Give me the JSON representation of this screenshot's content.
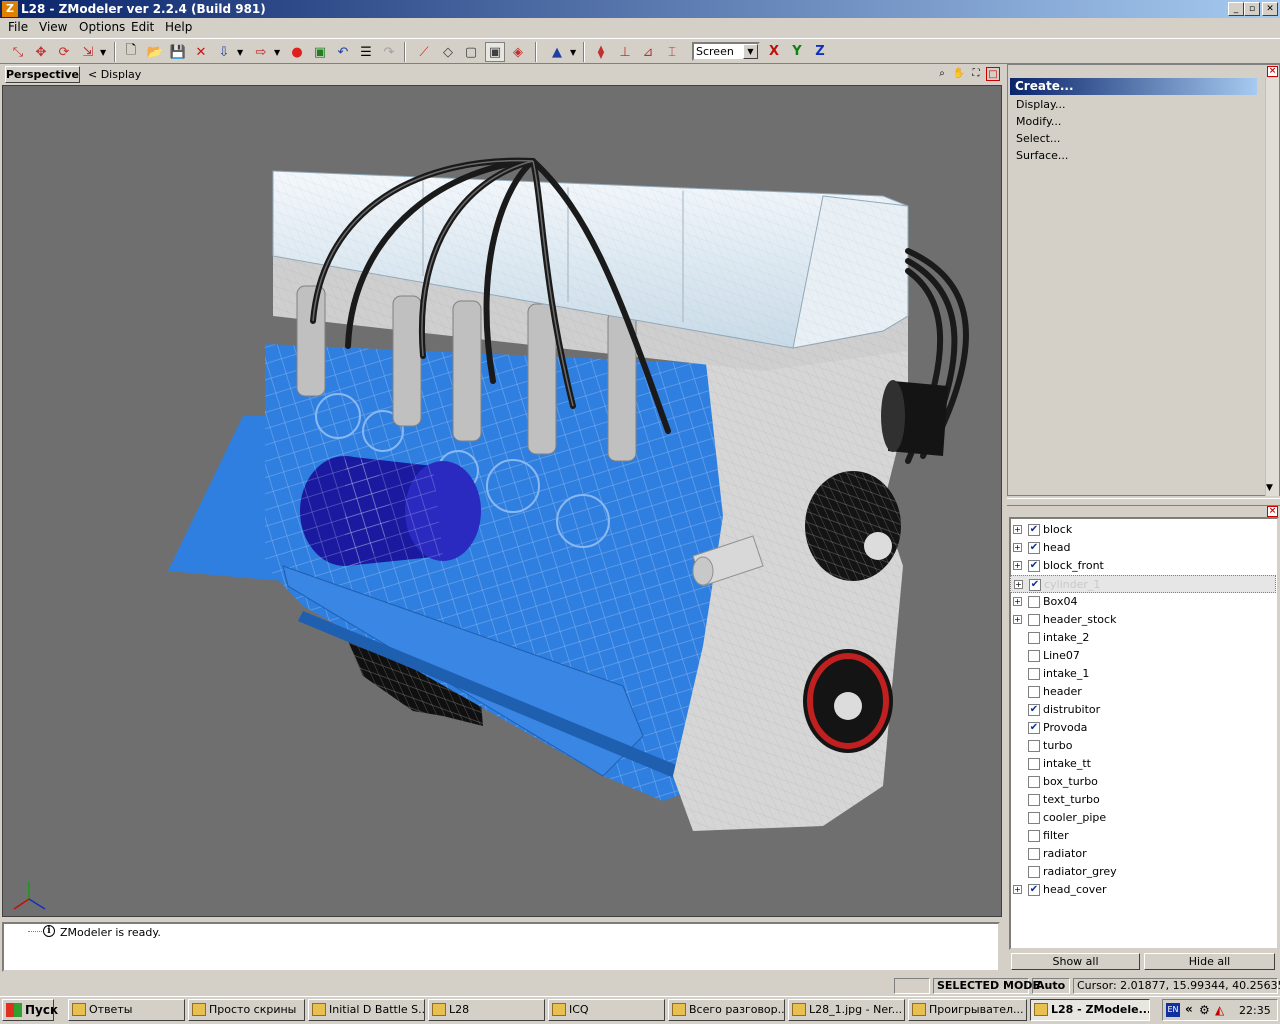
{
  "window": {
    "title": "L28 - ZModeler ver 2.2.4 (Build 981)",
    "logo": "Z",
    "min_glyph": "_",
    "max_glyph": "▫",
    "close_glyph": "✕"
  },
  "menu": [
    "File",
    "View",
    "Options",
    "Edit",
    "Help"
  ],
  "toolbar": {
    "screen_mode": "Screen",
    "axis_x": "X",
    "axis_y": "Y",
    "axis_z": "Z"
  },
  "viewport": {
    "tab": "Perspective",
    "display_label": "<  Display"
  },
  "right_panel": {
    "create": "Create...",
    "items": [
      "Display...",
      "Modify...",
      "Select...",
      "Surface..."
    ]
  },
  "objects": [
    {
      "name": "block",
      "checked": true,
      "expandable": true
    },
    {
      "name": "head",
      "checked": true,
      "expandable": true
    },
    {
      "name": "block_front",
      "checked": true,
      "expandable": true
    },
    {
      "name": "cylinder_1",
      "checked": true,
      "expandable": true,
      "selected": true
    },
    {
      "name": "Box04",
      "checked": false,
      "expandable": true
    },
    {
      "name": "header_stock",
      "checked": false,
      "expandable": true
    },
    {
      "name": "intake_2",
      "checked": false,
      "expandable": false
    },
    {
      "name": "Line07",
      "checked": false,
      "expandable": false
    },
    {
      "name": "intake_1",
      "checked": false,
      "expandable": false
    },
    {
      "name": "header",
      "checked": false,
      "expandable": false
    },
    {
      "name": "distrubitor",
      "checked": true,
      "expandable": false
    },
    {
      "name": "Provoda",
      "checked": true,
      "expandable": false
    },
    {
      "name": "turbo",
      "checked": false,
      "expandable": false
    },
    {
      "name": "intake_tt",
      "checked": false,
      "expandable": false
    },
    {
      "name": "box_turbo",
      "checked": false,
      "expandable": false
    },
    {
      "name": "text_turbo",
      "checked": false,
      "expandable": false
    },
    {
      "name": "cooler_pipe",
      "checked": false,
      "expandable": false
    },
    {
      "name": "filter",
      "checked": false,
      "expandable": false
    },
    {
      "name": "radiator",
      "checked": false,
      "expandable": false
    },
    {
      "name": "radiator_grey",
      "checked": false,
      "expandable": false
    },
    {
      "name": "head_cover",
      "checked": true,
      "expandable": true
    }
  ],
  "buttons": {
    "show_all": "Show all",
    "hide_all": "Hide all"
  },
  "log": {
    "message": "ZModeler is ready."
  },
  "status": {
    "mode": "SELECTED MODE",
    "auto": "Auto",
    "cursor": "Cursor: 2.01877, 15.99344, 40.25635"
  },
  "taskbar": {
    "start": "Пуск",
    "tasks": [
      {
        "label": "Ответы",
        "active": false
      },
      {
        "label": "Просто скрины",
        "active": false
      },
      {
        "label": "Initial D Battle S...",
        "active": false
      },
      {
        "label": "L28",
        "active": false
      },
      {
        "label": "ICQ",
        "active": false
      },
      {
        "label": "Всего разговор...",
        "active": false
      },
      {
        "label": "L28_1.jpg - Ner...",
        "active": false
      },
      {
        "label": "Проигрывател...",
        "active": false
      },
      {
        "label": "L28 - ZModele...",
        "active": true
      }
    ],
    "lang": "EN",
    "clock": "22:35"
  },
  "colors": {
    "block_blue": "#2f7fe0",
    "cylinder_navy": "#1a1aa0",
    "pulley_red": "#c02020",
    "viewport_bg": "#6f6f6f"
  }
}
